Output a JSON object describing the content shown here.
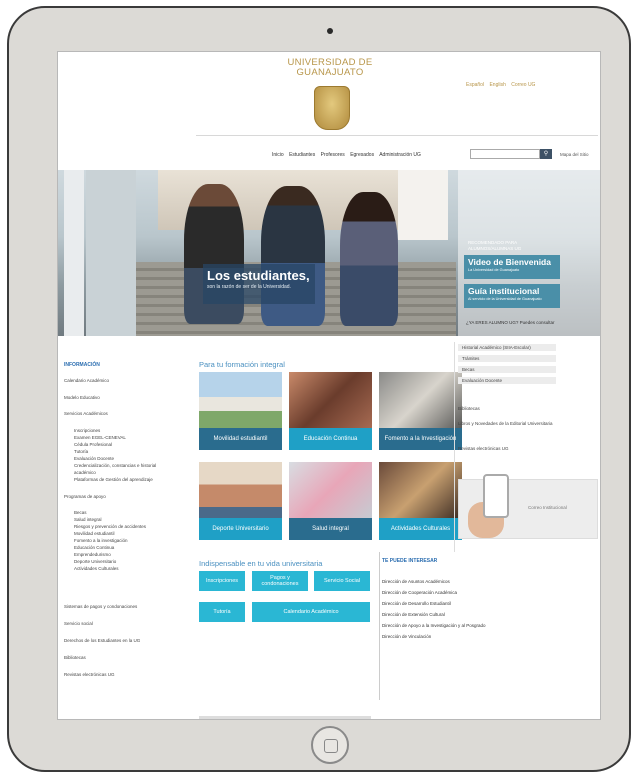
{
  "header": {
    "university_line1": "UNIVERSIDAD DE",
    "university_line2": "GUANAJUATO",
    "lang_es": "Español",
    "lang_en": "English",
    "correo": "Correo UG"
  },
  "nav": {
    "items": [
      "Inicio",
      "Estudiantes",
      "Profesores",
      "Egresados",
      "Administración UG"
    ],
    "mapa": "Mapa del Sitio"
  },
  "hero": {
    "title": "Los estudiantes,",
    "subtitle": "son la razón de ser de la Universidad.",
    "recomendado": "RECOMENDADO PARA ALUMNOS/ALUMNAS UG",
    "video_title": "Video de Bienvenida",
    "video_sub": "La Universidad de Guanajuato",
    "guia_title": "Guía institucional",
    "guia_sub": "Al servicio de la Universidad de Guanajuato",
    "alumno": "¿YA ERES ALUMNO UG? Puedes consultar"
  },
  "sidebar": {
    "heading": "INFORMACIÓN",
    "items": [
      "Calendario Académico",
      "Modelo Educativo",
      "Servicios Académicos",
      "Inscripciones",
      "Examen EGEL-CENEVAL",
      "Cédula Profesional",
      "Tutoría",
      "Evaluación Docente",
      "Credencialización, constancias e historial",
      "académico",
      "Plataformas de Gestión del aprendizaje",
      "Programas de apoyo",
      "Becas",
      "Salud integral",
      "Riesgos y prevención de accidentes",
      "Movilidad estudiantil",
      "Fomento a la investigación",
      "Educación Continua",
      "Emprendedurismo",
      "Deporte Universitario",
      "Actividades Culturales",
      "Sistemas de pagos y condonaciones",
      "Servicio social",
      "Derechos de los Estudiantes en la UG",
      "Bibliotecas",
      "Revistas electrónicas UG"
    ]
  },
  "main": {
    "section1": "Para tu formación integral",
    "tiles": [
      "Movilidad estudiantil",
      "Educación Continua",
      "Fomento a la Investigación",
      "Deporte Universitario",
      "Salud integral",
      "Actividades Culturales"
    ],
    "section2": "Indispensable en tu vida universitaria",
    "buttons": [
      "Inscripciones",
      "Pagos y condonaciones",
      "Servicio Social",
      "Tutoría",
      "Calendario Académico"
    ]
  },
  "right": {
    "list": [
      "Historial Académico (SIIA-Escolar)",
      "Trámites",
      "Becas",
      "Evaluación Docente"
    ],
    "extra": [
      "Bibliotecas",
      "Libros y Novedades de la Editorial Universitaria",
      "Revistas electrónicas UG"
    ],
    "phone_caption": "Correo Institucional",
    "interes_heading": "TE PUEDE INTERESAR",
    "interes": [
      "Dirección de Asuntos Académicos",
      "Dirección de Cooperación Académica",
      "Dirección de Desarrollo Estudiantil",
      "Dirección de Extensión Cultural",
      "Dirección de Apoyo a la Investigación y al Posgrado",
      "Dirección de Vinculación"
    ]
  }
}
